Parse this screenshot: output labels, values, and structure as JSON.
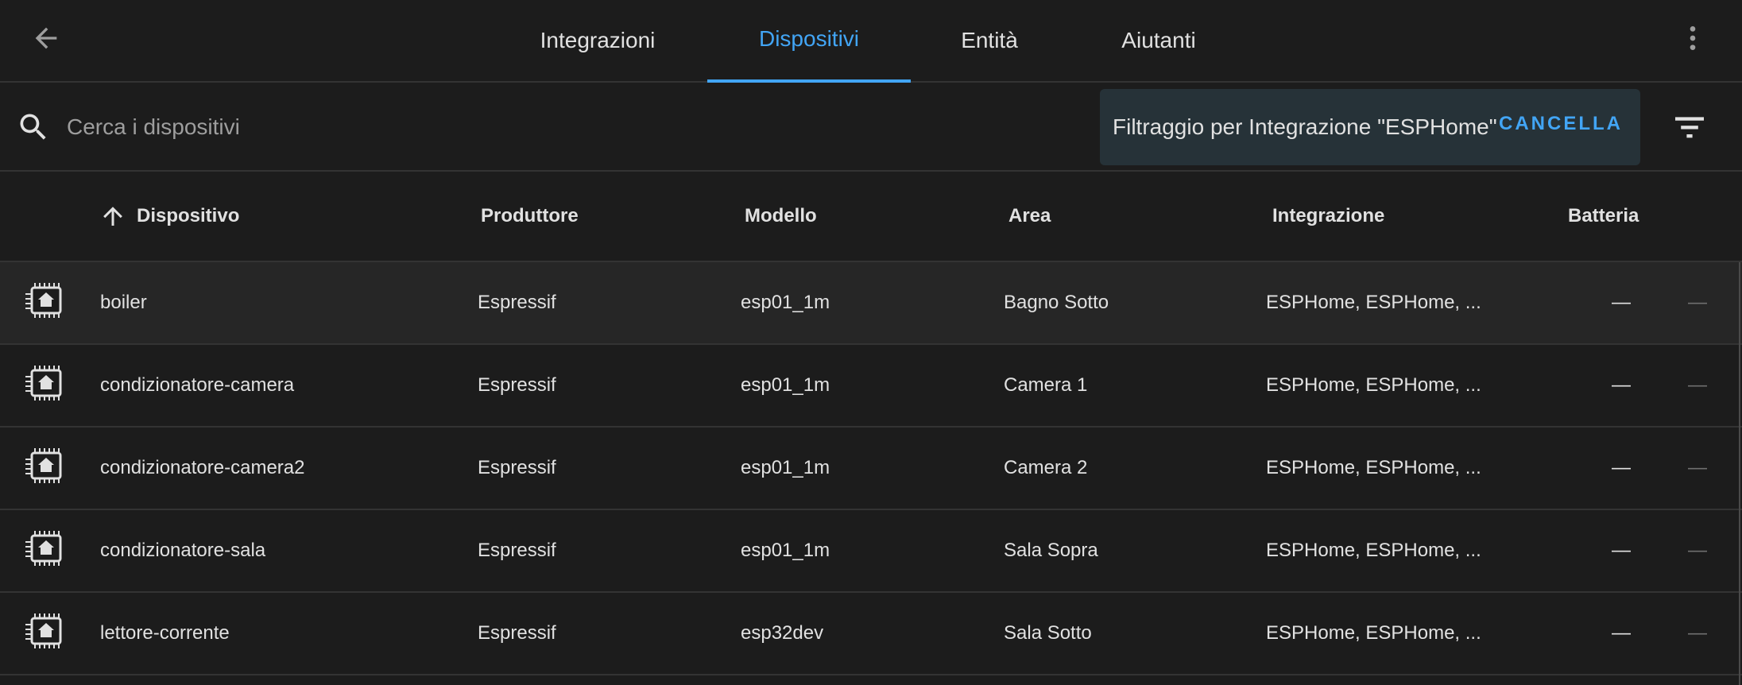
{
  "header": {
    "back_icon": "arrow-left-icon",
    "menu_icon": "dots-vertical-icon",
    "tabs": [
      {
        "label": "Integrazioni",
        "active": false
      },
      {
        "label": "Dispositivi",
        "active": true
      },
      {
        "label": "Entità",
        "active": false
      },
      {
        "label": "Aiutanti",
        "active": false
      }
    ]
  },
  "search": {
    "placeholder": "Cerca i dispositivi",
    "value": "",
    "icon": "magnify-icon"
  },
  "filter": {
    "text": "Filtraggio per Integrazione \"ESPHome\"",
    "clear_label": "CANCELLA",
    "filter_icon": "filter-variant-icon"
  },
  "table": {
    "sort_icon": "arrow-up-icon",
    "columns": {
      "device": "Dispositivo",
      "manufacturer": "Produttore",
      "model": "Modello",
      "area": "Area",
      "integration": "Integrazione",
      "battery": "Batteria"
    },
    "rows": [
      {
        "icon": "esphome-chip-icon",
        "device": "boiler",
        "manufacturer": "Espressif",
        "model": "esp01_1m",
        "area": "Bagno Sotto",
        "integration": "ESPHome, ESPHome, ...",
        "battery": "—",
        "extra": "—"
      },
      {
        "icon": "esphome-chip-icon",
        "device": "condizionatore-camera",
        "manufacturer": "Espressif",
        "model": "esp01_1m",
        "area": "Camera 1",
        "integration": "ESPHome, ESPHome, ...",
        "battery": "—",
        "extra": "—"
      },
      {
        "icon": "esphome-chip-icon",
        "device": "condizionatore-camera2",
        "manufacturer": "Espressif",
        "model": "esp01_1m",
        "area": "Camera 2",
        "integration": "ESPHome, ESPHome, ...",
        "battery": "—",
        "extra": "—"
      },
      {
        "icon": "esphome-chip-icon",
        "device": "condizionatore-sala",
        "manufacturer": "Espressif",
        "model": "esp01_1m",
        "area": "Sala Sopra",
        "integration": "ESPHome, ESPHome, ...",
        "battery": "—",
        "extra": "—"
      },
      {
        "icon": "esphome-chip-icon",
        "device": "lettore-corrente",
        "manufacturer": "Espressif",
        "model": "esp32dev",
        "area": "Sala Sotto",
        "integration": "ESPHome, ESPHome, ...",
        "battery": "—",
        "extra": "—"
      }
    ]
  },
  "colors": {
    "background": "#1c1c1c",
    "accent": "#42a5f5",
    "chip_background": "#263238",
    "divider": "#333333"
  }
}
